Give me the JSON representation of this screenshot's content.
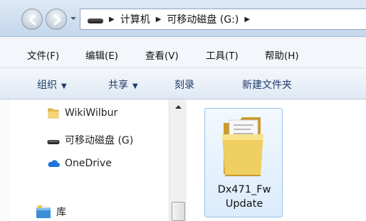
{
  "address_bar": {
    "crumbs": [
      "计算机",
      "可移动磁盘 (G:)"
    ]
  },
  "menu_bar": {
    "items": [
      "文件(F)",
      "编辑(E)",
      "查看(V)",
      "工具(T)",
      "帮助(H)"
    ]
  },
  "command_bar": {
    "organize": "组织",
    "share": "共享",
    "burn": "刻录",
    "new_folder": "新建文件夹"
  },
  "nav_pane": {
    "items": [
      {
        "label": "WikiWilbur",
        "icon": "folder-icon"
      },
      {
        "label": "可移动磁盘 (G)",
        "icon": "removable-drive-icon"
      },
      {
        "label": "OneDrive",
        "icon": "onedrive-cloud-icon"
      },
      {
        "label": "库",
        "icon": "library-icon"
      }
    ]
  },
  "content": {
    "items": [
      {
        "name_line1": "Dx471_Fw",
        "name_line2": "Update",
        "icon": "folder-icon",
        "selected": true
      }
    ]
  },
  "colors": {
    "command_text": "#1f3b6a",
    "selection_border": "#99c2ea",
    "selection_fill": "#dcecfc",
    "onedrive_blue": "#1e73d8",
    "folder_yellow": "#e8c04a"
  }
}
